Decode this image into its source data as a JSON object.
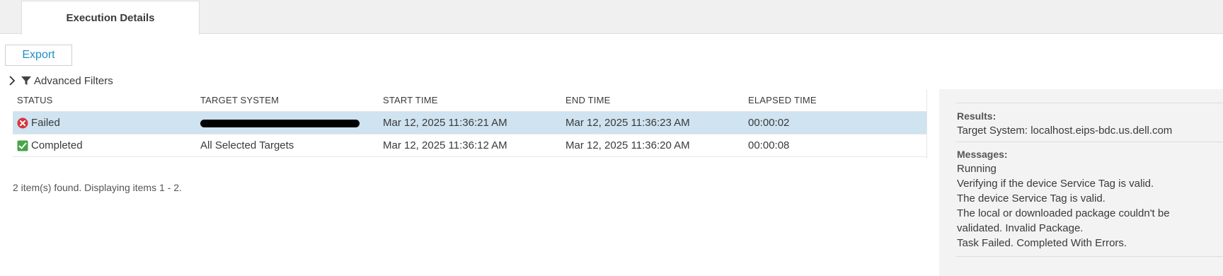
{
  "tabs": [
    {
      "label": "Execution Details"
    }
  ],
  "toolbar": {
    "export_label": "Export"
  },
  "filters": {
    "label": "Advanced Filters"
  },
  "table": {
    "columns": [
      "STATUS",
      "TARGET SYSTEM",
      "START TIME",
      "END TIME",
      "ELAPSED TIME"
    ],
    "rows": [
      {
        "status": "Failed",
        "status_icon": "error-x-icon",
        "target": "",
        "start": "Mar 12, 2025 11:36:21 AM",
        "end": "Mar 12, 2025 11:36:23 AM",
        "elapsed": "00:00:02",
        "selected": true
      },
      {
        "status": "Completed",
        "status_icon": "check-icon",
        "target": "All Selected Targets",
        "start": "Mar 12, 2025 11:36:12 AM",
        "end": "Mar 12, 2025 11:36:20 AM",
        "elapsed": "00:00:08",
        "selected": false
      }
    ]
  },
  "footer": {
    "found_text": "2 item(s) found. Displaying items 1 - 2."
  },
  "details": {
    "results_label": "Results:",
    "target_line": "Target System: localhost.eips-bdc.us.dell.com",
    "messages_label": "Messages:",
    "messages": [
      "Running",
      "Verifying if the device Service Tag is valid.",
      "The device Service Tag is valid.",
      "The local or downloaded package couldn't be",
      "validated. Invalid Package.",
      "Task Failed. Completed With Errors."
    ]
  },
  "colors": {
    "accent": "#1d8fc3",
    "selected_row": "#cfe3f0",
    "error": "#d9343a",
    "success": "#47a447",
    "panel": "#f3f3f3"
  }
}
